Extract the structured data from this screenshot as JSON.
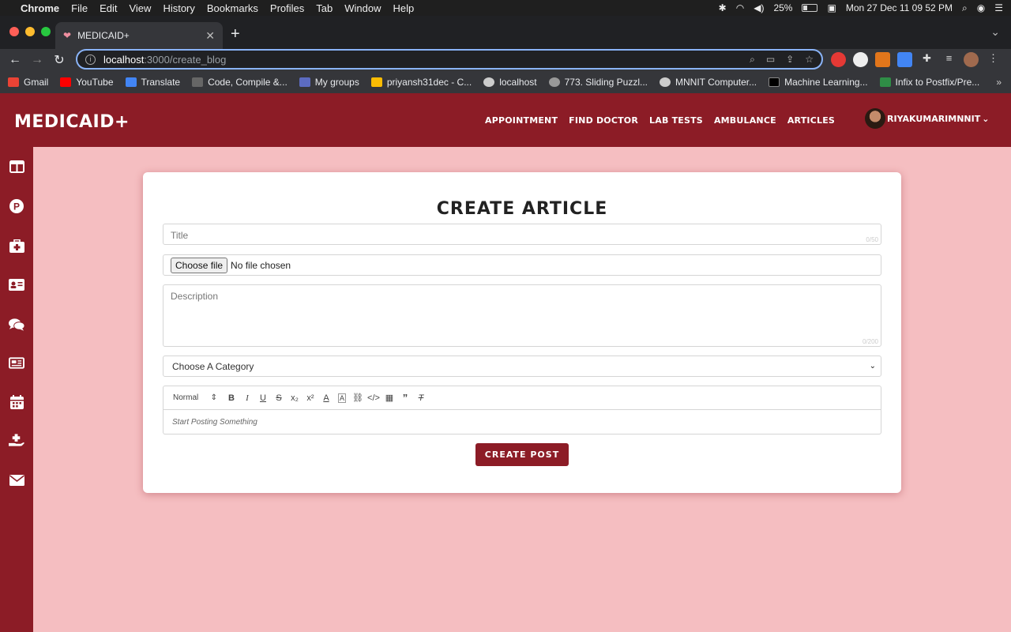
{
  "menubar": {
    "app": "Chrome",
    "items": [
      "File",
      "Edit",
      "View",
      "History",
      "Bookmarks",
      "Profiles",
      "Tab",
      "Window",
      "Help"
    ],
    "battery": "25%",
    "clock": "Mon 27 Dec  11 09 52 PM"
  },
  "browser": {
    "tab_title": "MEDICAID+",
    "url_host": "localhost",
    "url_path": ":3000/create_blog",
    "bookmarks": [
      "Gmail",
      "YouTube",
      "Translate",
      "Code, Compile &...",
      "My groups",
      "priyansh31dec - C...",
      "localhost",
      "773. Sliding Puzzl...",
      "MNNIT Computer...",
      "Machine Learning...",
      "Infix to Postfix/Pre..."
    ]
  },
  "app": {
    "logo": "MEDICAID+",
    "nav": [
      "APPOINTMENT",
      "FIND DOCTOR",
      "LAB TESTS",
      "AMBULANCE",
      "ARTICLES"
    ],
    "username": "RIYAKUMARIMNNIT"
  },
  "form": {
    "heading": "CREATE ARTICLE",
    "title_placeholder": "Title",
    "title_counter": "0/50",
    "file_button": "Choose file",
    "file_status": "No file chosen",
    "description_placeholder": "Description",
    "description_counter": "0/200",
    "category_placeholder": "Choose A Category",
    "editor_format": "Normal",
    "editor_placeholder": "Start Posting Something",
    "submit_label": "CREATE POST"
  },
  "colors": {
    "brand": "#8c1c26",
    "page_background": "#f5bec1"
  }
}
